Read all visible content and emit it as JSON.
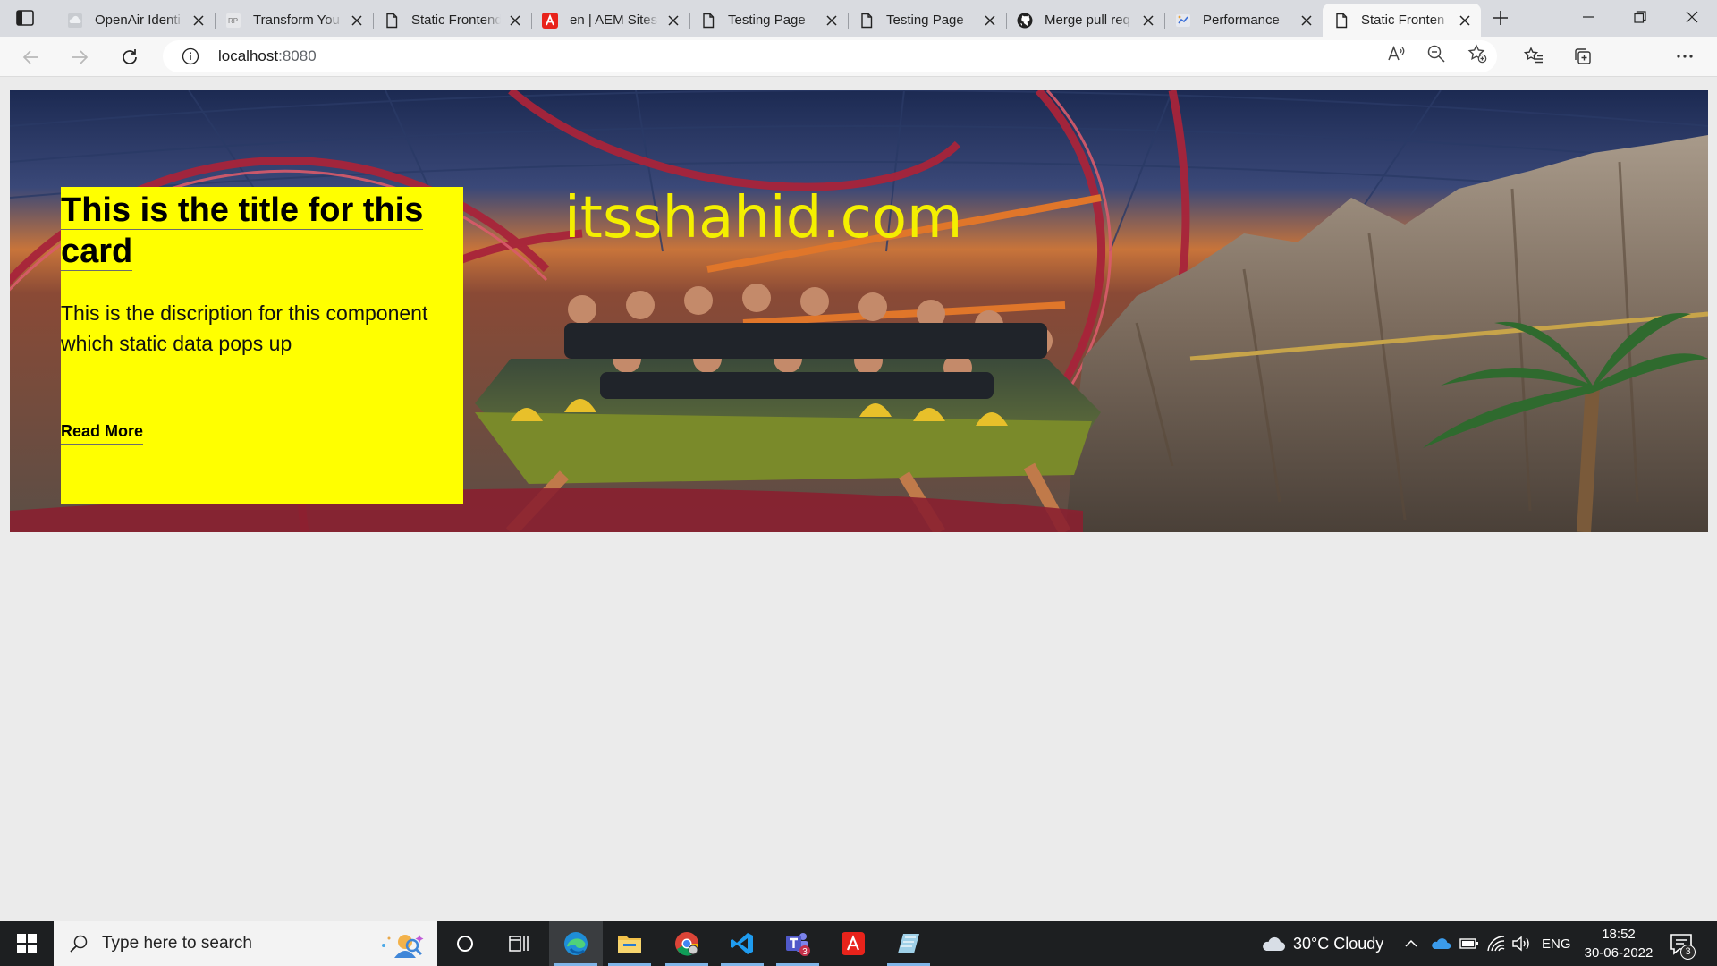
{
  "browser": {
    "tabs": [
      {
        "title": "OpenAir Identi",
        "icon": "cloud-favicon-icon"
      },
      {
        "title": "Transform You",
        "icon": "rp-favicon-icon"
      },
      {
        "title": "Static Frontend",
        "icon": "page-favicon-icon"
      },
      {
        "title": "en | AEM Sites",
        "icon": "adobe-favicon-icon"
      },
      {
        "title": "Testing Page",
        "icon": "page-favicon-icon"
      },
      {
        "title": "Testing Page",
        "icon": "page-favicon-icon"
      },
      {
        "title": "Merge pull req",
        "icon": "github-favicon-icon"
      },
      {
        "title": "Performance",
        "icon": "performance-favicon-icon"
      },
      {
        "title": "Static Fronten",
        "icon": "page-favicon-icon",
        "active": true
      }
    ],
    "address": {
      "host": "localhost",
      "port": ":8080"
    }
  },
  "page": {
    "brand": "itsshahid.com",
    "card": {
      "title": "This is the title for this card",
      "description": "This is the discription for this component which static data pops up",
      "link": "Read More"
    }
  },
  "taskbar": {
    "search_placeholder": "Type here to search",
    "weather": "30°C  Cloudy",
    "language": "ENG",
    "time": "18:52",
    "date": "30-06-2022",
    "teams_badge": "3",
    "notification_count": "3"
  },
  "colors": {
    "card_background": "#ffff00",
    "brand_text": "#f4ef00",
    "taskbar": "#1d1f21"
  }
}
